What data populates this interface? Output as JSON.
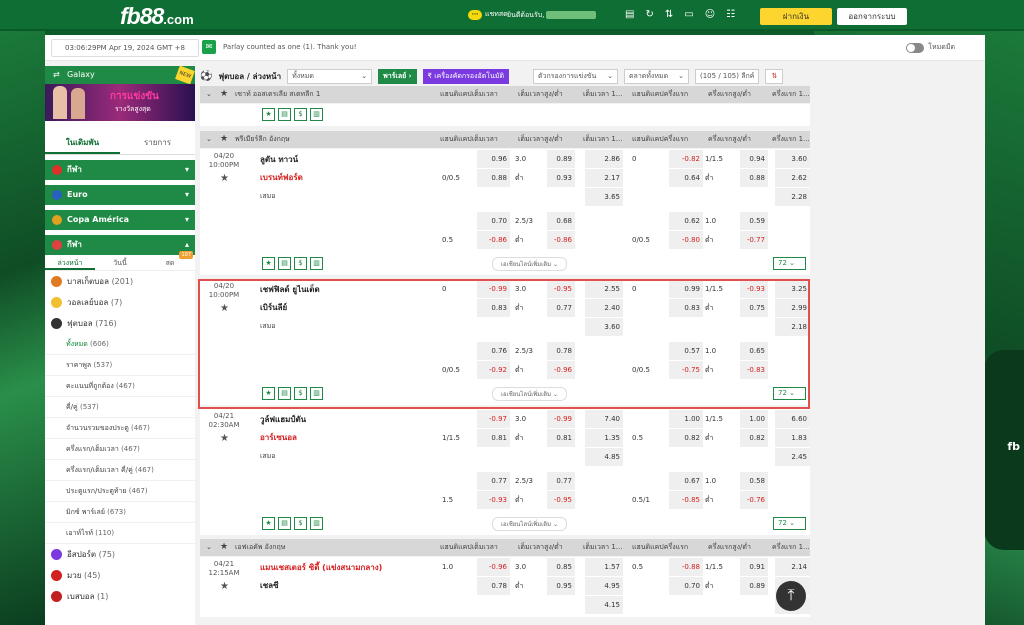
{
  "brand": {
    "name": "fb88",
    "suffix": ".com"
  },
  "topbar": {
    "chat": "แชทสด",
    "welcome": "ยินดีต้อนรับ,",
    "deposit": "ฝากเงิน",
    "logout": "ออกจากระบบ"
  },
  "timebar": {
    "time": "03:06:29PM Apr 19, 2024 GMT +8",
    "message": "Parlay counted as one (1). Thank you!",
    "dark": "โหมดมืด"
  },
  "sidebar": {
    "galaxy": "Galaxy",
    "banner_title": "การแข่งขัน",
    "banner_sub": "รางวัลสูงสุด",
    "tabs": [
      "ในเดิมพัน",
      "รายการ"
    ],
    "groups": [
      {
        "name": "กีฬา"
      },
      {
        "name": "Euro"
      },
      {
        "name": "Copa América"
      },
      {
        "name": "กีฬา"
      }
    ],
    "subtabs": [
      "ล่วงหน้า",
      "วันนี้",
      "สด"
    ],
    "badge": "107",
    "sports": [
      {
        "name": "บาสเก็ตบอล",
        "count": "(201)"
      },
      {
        "name": "วอลเลย์บอล",
        "count": "(7)"
      },
      {
        "name": "ฟุตบอล",
        "count": "(716)"
      }
    ],
    "soccer_items": [
      {
        "name": "ทั้งหมด",
        "count": "(606)"
      },
      {
        "name": "ราคาพูล",
        "count": "(537)"
      },
      {
        "name": "คะแนนที่ถูกต้อง",
        "count": "(467)"
      },
      {
        "name": "คี่/คู่",
        "count": "(537)"
      },
      {
        "name": "จำนวนรวมของประตู",
        "count": "(467)"
      },
      {
        "name": "ครึ่งแรก/เต็มเวลา",
        "count": "(467)"
      },
      {
        "name": "ครึ่งแรก/เต็มเวลา คี่/คู่",
        "count": "(467)"
      },
      {
        "name": "ประตูแรก/ประตูท้าย",
        "count": "(467)"
      },
      {
        "name": "มิกซ์ พาร์เลย์",
        "count": "(673)"
      },
      {
        "name": "เอาท์ไรท์",
        "count": "(110)"
      }
    ],
    "more_sports": [
      {
        "name": "อีสปอร์ต",
        "count": "(75)"
      },
      {
        "name": "มวย",
        "count": "(45)"
      },
      {
        "name": "เบสบอล",
        "count": "(1)"
      }
    ]
  },
  "filter": {
    "title": "ฟุตบอล / ล่วงหน้า",
    "all": "ทั้งหมด",
    "parlay": "พาร์เลย์",
    "tool": "เครื่องคัดกรองอัตโนมัติ",
    "sort": "ตัวกรองการแข่งขัน",
    "market": "ตลาดทั้งหมด",
    "count": "(105 / 105) ลีกค์"
  },
  "cols": [
    "แฮนดิแคปเต็มเวลา",
    "เต็มเวลาสูง/ต่ำ",
    "เต็มเวลา 1...",
    "แฮนดิแคปครึ่งแรก",
    "ครึ่งแรกสูง/ต่ำ",
    "ครึ่งแรก 1..."
  ],
  "leagues": [
    "เซาท์ ออสเตรเลีย สเตทลีก 1",
    "พรีเมียร์ลีก อังกฤษ",
    "เอฟเอคัพ อังกฤษ"
  ],
  "matches": [
    {
      "date": "04/20",
      "time": "10:00PM",
      "home": "ลูตัน ทาวน์",
      "away": "เบรนท์ฟอร์ด",
      "draw": "เสมอ",
      "r1": [
        "",
        "0.96",
        "3.0",
        "0.89",
        "2.86",
        "0",
        "-0.82",
        "1/1.5",
        "0.94",
        "3.60"
      ],
      "r2": [
        "0/0.5",
        "0.88",
        "ต่ำ",
        "0.93",
        "2.17",
        "",
        "0.64",
        "ต่ำ",
        "0.88",
        "2.62"
      ],
      "r3": [
        "3.65",
        "2.28"
      ],
      "r4": [
        "",
        "0.70",
        "2.5/3",
        "0.68",
        "",
        "0.62",
        "1.0",
        "0.59"
      ],
      "r5": [
        "0.5",
        "-0.86",
        "ต่ำ",
        "-0.86",
        "0/0.5",
        "-0.80",
        "ต่ำ",
        "-0.77"
      ]
    },
    {
      "date": "04/20",
      "time": "10:00PM",
      "home": "เชฟฟิลด์ ยูไนเต็ด",
      "away": "เบิร์นลีย์",
      "draw": "เสมอ",
      "r1": [
        "0",
        "-0.99",
        "3.0",
        "-0.95",
        "2.55",
        "0",
        "0.99",
        "1/1.5",
        "-0.93",
        "3.25"
      ],
      "r2": [
        "",
        "0.83",
        "ต่ำ",
        "0.77",
        "2.40",
        "",
        "0.83",
        "ต่ำ",
        "0.75",
        "2.99"
      ],
      "r3": [
        "3.60",
        "2.18"
      ],
      "r4": [
        "",
        "0.76",
        "2.5/3",
        "0.78",
        "",
        "0.57",
        "1.0",
        "0.65"
      ],
      "r5": [
        "0/0.5",
        "-0.92",
        "ต่ำ",
        "-0.96",
        "0/0.5",
        "-0.75",
        "ต่ำ",
        "-0.83"
      ]
    },
    {
      "date": "04/21",
      "time": "02:30AM",
      "home": "วูล์ฟแฮมป์ตัน",
      "away": "อาร์เซนอล",
      "draw": "เสมอ",
      "r1": [
        "",
        "-0.97",
        "3.0",
        "-0.99",
        "7.40",
        "",
        "1.00",
        "1/1.5",
        "1.00",
        "6.60"
      ],
      "r2": [
        "1/1.5",
        "0.81",
        "ต่ำ",
        "0.81",
        "1.35",
        "0.5",
        "0.82",
        "ต่ำ",
        "0.82",
        "1.83"
      ],
      "r3": [
        "4.85",
        "2.45"
      ],
      "r4": [
        "",
        "0.77",
        "2.5/3",
        "0.77",
        "",
        "0.67",
        "1.0",
        "0.58"
      ],
      "r5": [
        "1.5",
        "-0.93",
        "ต่ำ",
        "-0.95",
        "0.5/1",
        "-0.85",
        "ต่ำ",
        "-0.76"
      ]
    },
    {
      "date": "04/21",
      "time": "12:15AM",
      "home": "แมนเชสเตอร์ ซิตี้ (แข่งสนามกลาง)",
      "away": "เชลซี",
      "draw": "",
      "r1": [
        "1.0",
        "-0.96",
        "3.0",
        "0.85",
        "1.57",
        "0.5",
        "-0.88",
        "1/1.5",
        "0.91",
        "2.14"
      ],
      "r2": [
        "",
        "0.78",
        "ต่ำ",
        "0.95",
        "4.95",
        "",
        "0.70",
        "ต่ำ",
        "0.89",
        ""
      ],
      "r3": [
        "4.15",
        ""
      ]
    }
  ],
  "more_bets": "เอเชียนไลน์เพิ่มเติม",
  "count72": "72"
}
